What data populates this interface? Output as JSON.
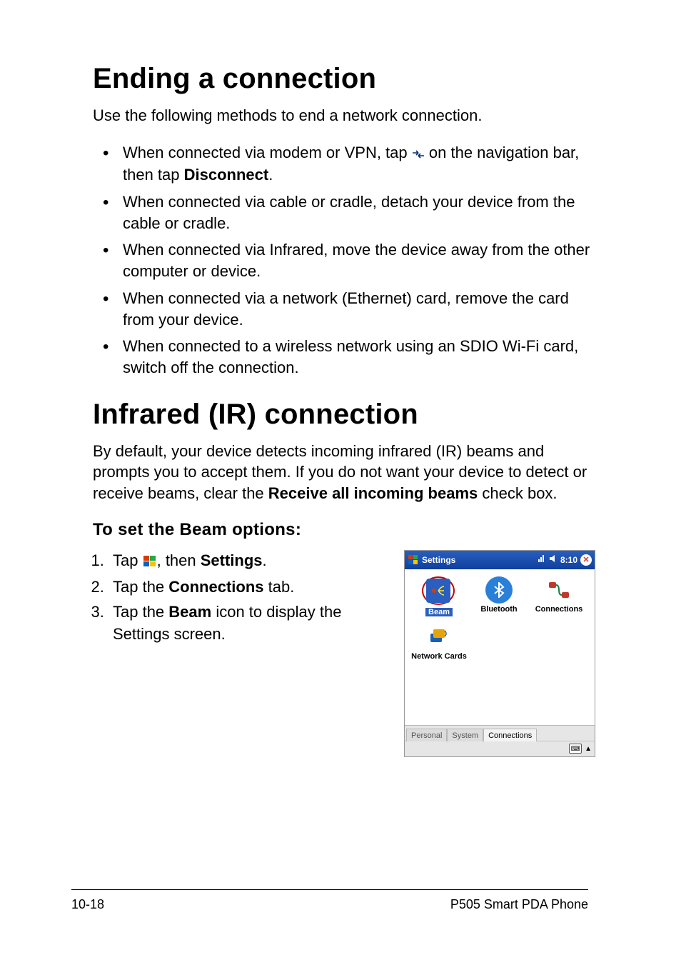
{
  "section1": {
    "heading": "Ending a connection",
    "intro": "Use the following methods to end a network connection.",
    "bullets": [
      {
        "pre": "When connected via modem or VPN, tap ",
        "icon": "conn",
        "mid": " on the navigation bar, then tap ",
        "bold": "Disconnect",
        "post": "."
      },
      {
        "text": "When connected via cable or cradle, detach your device from the cable or cradle."
      },
      {
        "text": "When connected via Infrared, move the device away from the other computer or device."
      },
      {
        "text": "When connected via a network (Ethernet) card, remove the card from your device."
      },
      {
        "text": "When connected to a wireless network using an SDIO Wi-Fi card, switch off the connection."
      }
    ]
  },
  "section2": {
    "heading": "Infrared (IR) connection",
    "intro_pre": "By default, your device detects incoming infrared (IR) beams and prompts you to accept them. If you do not want your device to detect or receive beams, clear the ",
    "intro_bold": "Receive all incoming beams",
    "intro_post": " check box.",
    "subheading": "To set the Beam options:",
    "steps": {
      "s1_pre": "Tap ",
      "s1_mid": ", then ",
      "s1_bold": "Settings",
      "s1_post": ".",
      "s2_pre": "Tap the ",
      "s2_bold": "Connections",
      "s2_post": " tab.",
      "s3_pre": "Tap the ",
      "s3_bold": "Beam",
      "s3_post": " icon to display the Settings screen."
    }
  },
  "screenshot": {
    "title": "Settings",
    "time": "8:10",
    "icons": {
      "beam": "Beam",
      "bt": "Bluetooth",
      "conn": "Connections",
      "net": "Network Cards"
    },
    "tabs": {
      "personal": "Personal",
      "system": "System",
      "connections": "Connections"
    }
  },
  "footer": {
    "left": "10-18",
    "right": "P505 Smart PDA Phone"
  }
}
